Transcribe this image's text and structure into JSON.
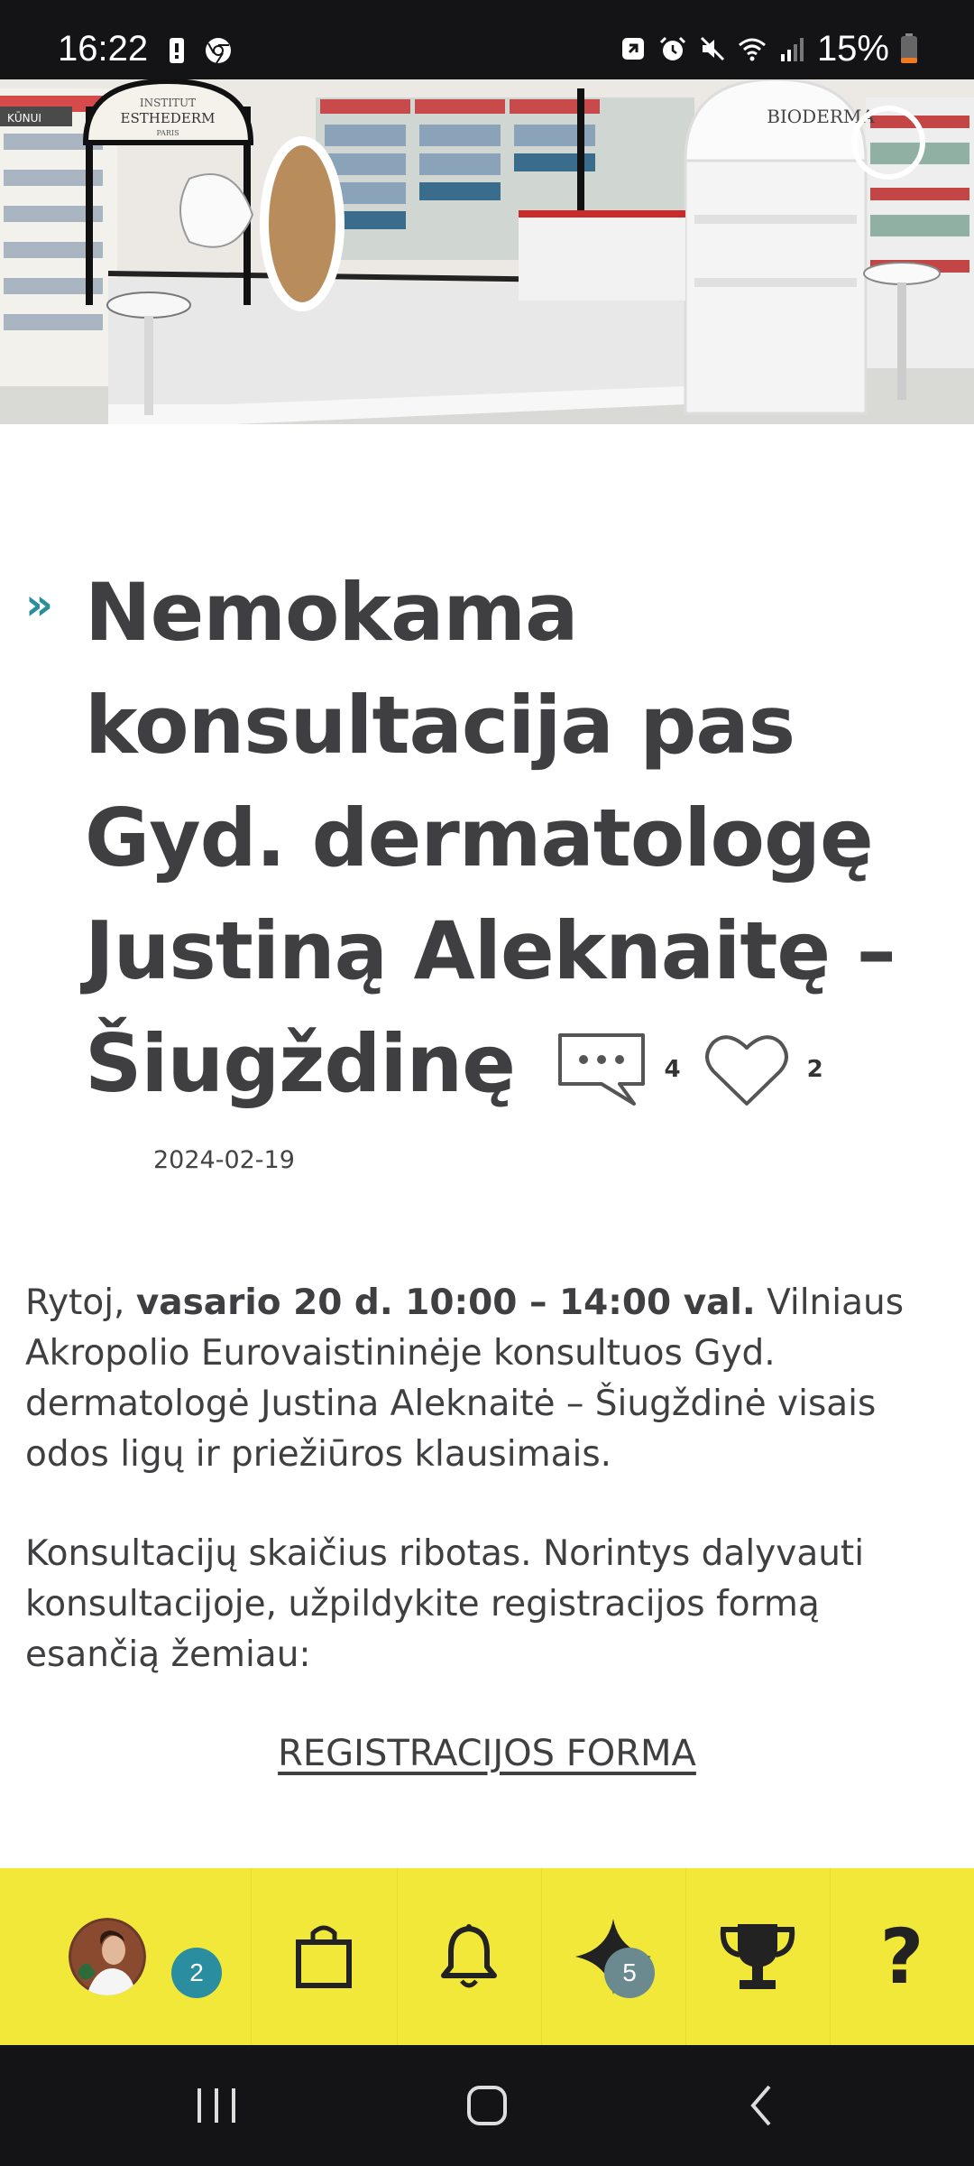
{
  "status_bar": {
    "time": "16:22",
    "battery_percent": "15%",
    "left_icons": [
      "phone-icon",
      "chrome-icon"
    ],
    "right_icons": [
      "notification-icon",
      "alarm-icon",
      "mute-icon",
      "wifi-icon",
      "signal-icon",
      "battery-icon"
    ]
  },
  "hero": {
    "store_sign_left": "INSTITUT",
    "brand_left": "ESTHEDERM",
    "brand_left_sub": "PARIS",
    "brand_right": "BIODERMA",
    "shelf_label": "KŪNUI"
  },
  "article": {
    "title": "Nemokama konsultacija pas Gyd. dermatologę Justiną Aleknaitę – Šiugždinę",
    "comments_count": "4",
    "likes_count": "2",
    "date": "2024-02-19",
    "para1_start": "Rytoj, ",
    "para1_bold": "vasario 20 d. 10:00 – 14:00 val.",
    "para1_rest": " Vilniaus Akropolio Eurovaistininėje konsultuos Gyd. dermatologė Justina Aleknaitė – Šiugždinė visais odos ligų ir priežiūros klausimais.",
    "para2": "Konsultacijų skaičius ribotas. Norintys dalyvauti konsultacijoje, užpildykite registracijos formą esančią žemiau:",
    "registration_link": "REGISTRACIJOS FORMA"
  },
  "toolbar": {
    "profile_badge": "2",
    "star_badge": "5",
    "help_label": "?",
    "background": "#f1e83a"
  },
  "colors": {
    "accent": "#2a8f9a",
    "text": "#3f3f41",
    "toolbar": "#f1e83a"
  }
}
